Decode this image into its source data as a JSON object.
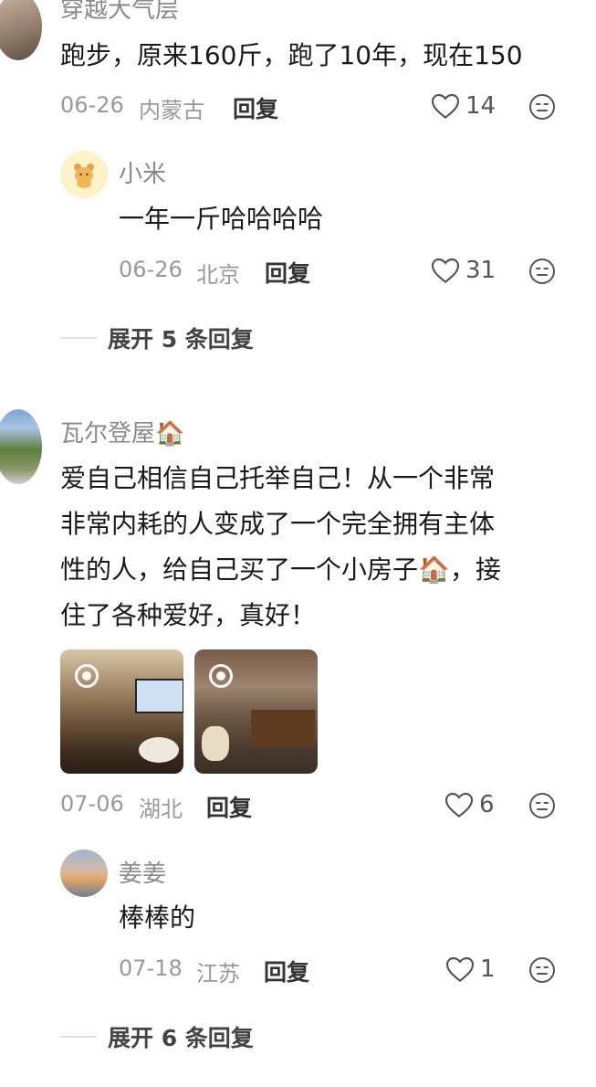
{
  "comments": [
    {
      "username": "穿越大气层",
      "text": "跑步，原来160斤，跑了10年，现在150",
      "date": "06-26",
      "location": "内蒙古",
      "reply_label": "回复",
      "likes": "14",
      "replies": [
        {
          "username": "小米",
          "text": "一年一斤哈哈哈哈",
          "date": "06-26",
          "location": "北京",
          "reply_label": "回复",
          "likes": "31"
        }
      ],
      "expand_label": "展开 5 条回复"
    },
    {
      "username": "瓦尔登屋",
      "username_emoji": "🏠",
      "text_lines": [
        "爱自己相信自己托举自己！从一个非常",
        "非常内耗的人变成了一个完全拥有主体",
        "性的人，给自己买了一个小房子🏠，接",
        "住了各种爱好，真好！"
      ],
      "date": "07-06",
      "location": "湖北",
      "reply_label": "回复",
      "likes": "6",
      "replies": [
        {
          "username": "姜姜",
          "text": "棒棒的",
          "date": "07-18",
          "location": "江苏",
          "reply_label": "回复",
          "likes": "1"
        }
      ],
      "expand_label": "展开 6 条回复"
    }
  ],
  "icons": {
    "like": "heart-outline-icon",
    "dislike": "neutral-face-icon",
    "media": "video-play-icon"
  },
  "colors": {
    "username": "#8a8a8a",
    "meta": "#999999",
    "text": "#1a1a1a"
  }
}
